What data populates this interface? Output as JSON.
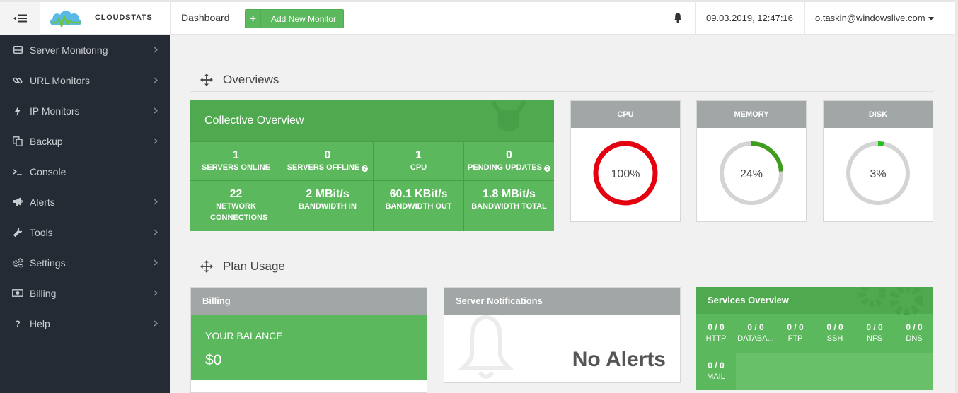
{
  "app": {
    "brand": "CLOUDSTATS",
    "brand_color": "#5cb85c",
    "sidebar_bg": "#252b34"
  },
  "header": {
    "menu_icon": "menu-collapse-icon",
    "nav_dashboard": "Dashboard",
    "add_monitor_icon": "plus-icon",
    "add_monitor_label": "Add New Monitor",
    "notifications_icon": "bell-icon",
    "datetime": "09.03.2019, 12:47:16",
    "user_email": "o.taskin@windowslive.com"
  },
  "sidebar": {
    "items": [
      {
        "label": "Server Monitoring",
        "icon": "server-icon",
        "has_submenu": true
      },
      {
        "label": "URL Monitors",
        "icon": "link-icon",
        "has_submenu": true
      },
      {
        "label": "IP Monitors",
        "icon": "bolt-icon",
        "has_submenu": true
      },
      {
        "label": "Backup",
        "icon": "copy-icon",
        "has_submenu": true
      },
      {
        "label": "Console",
        "icon": "terminal-icon",
        "has_submenu": false
      },
      {
        "label": "Alerts",
        "icon": "megaphone-icon",
        "has_submenu": true
      },
      {
        "label": "Tools",
        "icon": "wrench-icon",
        "has_submenu": true
      },
      {
        "label": "Settings",
        "icon": "cogs-icon",
        "has_submenu": true
      },
      {
        "label": "Billing",
        "icon": "money-icon",
        "has_submenu": true
      },
      {
        "label": "Help",
        "icon": "question-icon",
        "has_submenu": true
      }
    ]
  },
  "overviews": {
    "title": "Overviews",
    "collective": {
      "title": "Collective Overview",
      "stats": [
        {
          "value": "1",
          "label": "SERVERS ONLINE",
          "info": false
        },
        {
          "value": "0",
          "label": "SERVERS OFFLINE",
          "info": true
        },
        {
          "value": "1",
          "label": "CPU",
          "info": false
        },
        {
          "value": "0",
          "label": "PENDING UPDATES",
          "info": true
        },
        {
          "value": "22",
          "label": "NETWORK CONNECTIONS",
          "info": false
        },
        {
          "value": "2 MBit/s",
          "label": "BANDWIDTH IN",
          "info": false
        },
        {
          "value": "60.1 KBit/s",
          "label": "BANDWIDTH OUT",
          "info": false
        },
        {
          "value": "1.8 MBit/s",
          "label": "BANDWIDTH TOTAL",
          "info": false
        }
      ]
    },
    "gauges": [
      {
        "title": "CPU",
        "text": "100%",
        "value": 1.0,
        "color": "#e3000f"
      },
      {
        "title": "MEMORY",
        "text": "24%",
        "value": 0.24,
        "color": "#3f9c1f"
      },
      {
        "title": "DISK",
        "text": "3%",
        "value": 0.03,
        "color": "#22c11f"
      }
    ]
  },
  "plan_usage": {
    "title": "Plan Usage",
    "billing": {
      "title": "Billing",
      "balance_label": "YOUR BALANCE",
      "balance_value": "$0"
    },
    "notifications": {
      "title": "Server Notifications",
      "empty_text": "No Alerts"
    },
    "services": {
      "title": "Services Overview",
      "items": [
        {
          "value": "0 / 0",
          "label": "HTTP"
        },
        {
          "value": "0 / 0",
          "label": "DATABA..."
        },
        {
          "value": "0 / 0",
          "label": "FTP"
        },
        {
          "value": "0 / 0",
          "label": "SSH"
        },
        {
          "value": "0 / 0",
          "label": "NFS"
        },
        {
          "value": "0 / 0",
          "label": "DNS"
        },
        {
          "value": "0 / 0",
          "label": "MAIL"
        }
      ]
    }
  }
}
